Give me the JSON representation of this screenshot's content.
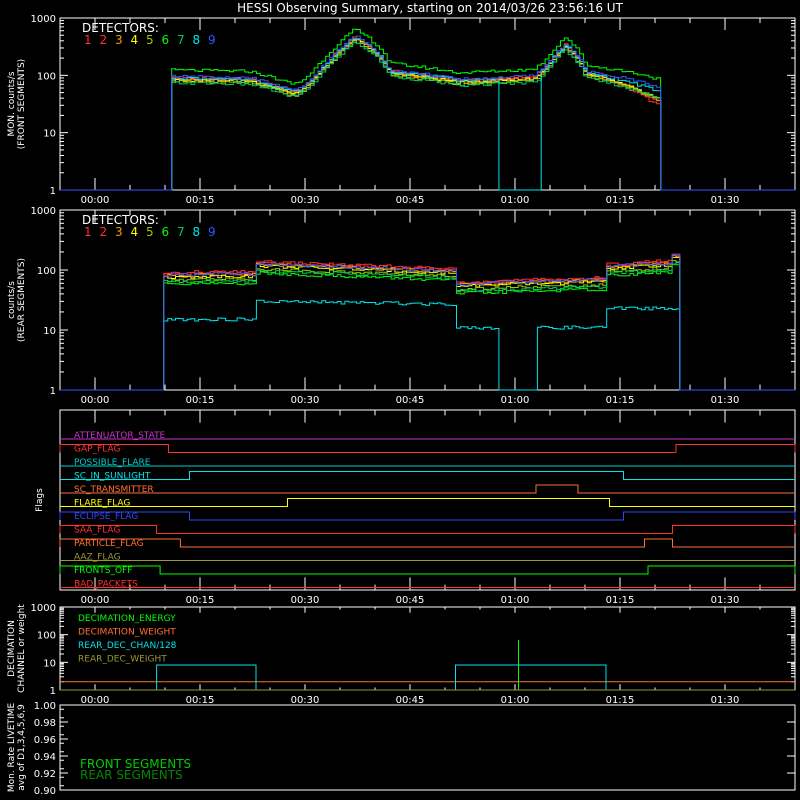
{
  "title": "HESSI Observing Summary, starting on 2014/03/26 23:56:16 UT",
  "chart_data": [
    {
      "type": "line",
      "panel": "front",
      "ylabel": [
        "MON. counts/s",
        "(FRONT SEGMENTS)"
      ],
      "ylog": true,
      "ylim": [
        1,
        1000
      ],
      "yticks": [
        "1",
        "10",
        "100",
        "1000"
      ],
      "xlim_minutes": [
        -5,
        100
      ],
      "xticks": [
        {
          "min": 0,
          "label": "00:00"
        },
        {
          "min": 15,
          "label": "00:15"
        },
        {
          "min": 30,
          "label": "00:30"
        },
        {
          "min": 45,
          "label": "00:45"
        },
        {
          "min": 60,
          "label": "01:00"
        },
        {
          "min": 75,
          "label": "01:15"
        },
        {
          "min": 90,
          "label": "01:30"
        }
      ],
      "legend_title": "DETECTORS:",
      "legend_location": "top-left",
      "series": [
        {
          "name": "1",
          "color": "#ff3030",
          "shape": "front",
          "scale": 0.92,
          "tail": 0.6
        },
        {
          "name": "2",
          "color": "#ff3030",
          "shape": "front",
          "scale": 0.95,
          "tail": 0.7
        },
        {
          "name": "3",
          "color": "#ff9900",
          "shape": "front",
          "scale": 0.9,
          "tail": 0.75
        },
        {
          "name": "4",
          "color": "#ffff00",
          "shape": "front",
          "scale": 0.88,
          "tail": 0.8
        },
        {
          "name": "5",
          "color": "#99cc00",
          "shape": "front",
          "scale": 0.82,
          "tail": 0.85
        },
        {
          "name": "6",
          "color": "#00ff00",
          "shape": "front",
          "scale": 1.3,
          "tail": 1.2
        },
        {
          "name": "7",
          "color": "#00cc66",
          "shape": "front",
          "scale": 0.78,
          "tail": 0.9
        },
        {
          "name": "8",
          "color": "#00e5ee",
          "shape": "front8",
          "scale": 0.95,
          "tail": 1.0
        },
        {
          "name": "9",
          "color": "#3355ff",
          "shape": "front",
          "scale": 1.0,
          "tail": 1.15
        }
      ]
    },
    {
      "type": "line",
      "panel": "rear",
      "ylabel": [
        "counts/s",
        "(REAR SEGMENTS)"
      ],
      "ylog": true,
      "ylim": [
        1,
        1000
      ],
      "yticks": [
        "1",
        "10",
        "100",
        "1000"
      ],
      "xlim_minutes": [
        -5,
        100
      ],
      "xticks": [
        {
          "min": 0,
          "label": "00:00"
        },
        {
          "min": 15,
          "label": "00:15"
        },
        {
          "min": 30,
          "label": "00:30"
        },
        {
          "min": 45,
          "label": "00:45"
        },
        {
          "min": 60,
          "label": "01:00"
        },
        {
          "min": 75,
          "label": "01:15"
        },
        {
          "min": 90,
          "label": "01:30"
        }
      ],
      "legend_title": "DETECTORS:",
      "legend_location": "top-left",
      "series": [
        {
          "name": "1",
          "color": "#ff3030",
          "shape": "rear",
          "scale": 1.05
        },
        {
          "name": "2",
          "color": "#ff3030",
          "shape": "rear",
          "scale": 1.0
        },
        {
          "name": "3",
          "color": "#ff9900",
          "shape": "rear",
          "scale": 0.95
        },
        {
          "name": "4",
          "color": "#ffff00",
          "shape": "rear",
          "scale": 0.9
        },
        {
          "name": "5",
          "color": "#99cc00",
          "shape": "rear",
          "scale": 0.8
        },
        {
          "name": "6",
          "color": "#00ff00",
          "shape": "rear",
          "scale": 0.68
        },
        {
          "name": "7",
          "color": "#00cc66",
          "shape": "rear",
          "scale": 0.75
        },
        {
          "name": "8",
          "color": "#00e5ee",
          "shape": "rear8",
          "scale": 1.0
        },
        {
          "name": "9",
          "color": "#3355ff",
          "shape": "rear",
          "scale": 0.97
        }
      ]
    },
    {
      "type": "line",
      "panel": "flags",
      "ylabel": [
        "Flags"
      ],
      "xlim_minutes": [
        -5,
        100
      ],
      "xticks": [
        {
          "min": 0,
          "label": "00:00"
        },
        {
          "min": 15,
          "label": "00:15"
        },
        {
          "min": 30,
          "label": "00:30"
        },
        {
          "min": 45,
          "label": "00:45"
        },
        {
          "min": 60,
          "label": "01:00"
        },
        {
          "min": 75,
          "label": "01:15"
        },
        {
          "min": 90,
          "label": "01:30"
        }
      ],
      "series": [
        {
          "name": "ATTENUATOR_STATE",
          "color": "#cc33cc",
          "high_intervals": []
        },
        {
          "name": "GAP_FLAG",
          "color": "#ff3030",
          "high_intervals": [
            [
              -5,
              10.5
            ],
            [
              83,
              100
            ]
          ]
        },
        {
          "name": "POSSIBLE_FLARE",
          "color": "#00cccc",
          "high_intervals": []
        },
        {
          "name": "SC_IN_SUNLIGHT",
          "color": "#00e5ee",
          "high_intervals": [
            [
              13.5,
              75.5
            ]
          ]
        },
        {
          "name": "SC_TRANSMITTER",
          "color": "#ff7030",
          "high_intervals": [
            [
              63,
              69
            ]
          ]
        },
        {
          "name": "FLARE_FLAG",
          "color": "#ffff00",
          "high_intervals": [
            [
              27.5,
              73.5
            ]
          ]
        },
        {
          "name": "ECLIPSE_FLAG",
          "color": "#3344ff",
          "high_intervals": [
            [
              -5,
              13.5
            ],
            [
              75.5,
              100
            ]
          ]
        },
        {
          "name": "SAA_FLAG",
          "color": "#ff3030",
          "high_intervals": [
            [
              -5,
              8.8
            ],
            [
              82.5,
              100
            ]
          ]
        },
        {
          "name": "PARTICLE_FLAG",
          "color": "#ff7030",
          "high_intervals": [
            [
              -5,
              12.2
            ],
            [
              78.5,
              82.5
            ]
          ]
        },
        {
          "name": "AAZ_FLAG",
          "color": "#999933",
          "high_intervals": []
        },
        {
          "name": "FRONTS_OFF",
          "color": "#00ff00",
          "high_intervals": [
            [
              -5,
              9.3
            ],
            [
              79,
              100
            ]
          ]
        },
        {
          "name": "BAD_PACKETS",
          "color": "#ff3030",
          "high_intervals": []
        }
      ]
    },
    {
      "type": "line",
      "panel": "decimation",
      "ylabel": [
        "DECIMATION",
        "CHANNEL or weight"
      ],
      "ylog": true,
      "ylim": [
        1,
        1000
      ],
      "yticks": [
        "1",
        "10",
        "100",
        "1000"
      ],
      "xlim_minutes": [
        -5,
        100
      ],
      "xticks": [
        {
          "min": 0,
          "label": "00:00"
        },
        {
          "min": 15,
          "label": "00:15"
        },
        {
          "min": 30,
          "label": "00:30"
        },
        {
          "min": 45,
          "label": "00:45"
        },
        {
          "min": 60,
          "label": "01:00"
        },
        {
          "min": 75,
          "label": "01:15"
        },
        {
          "min": 90,
          "label": "01:30"
        }
      ],
      "series": [
        {
          "name": "DECIMATION_ENERGY",
          "color": "#00ff00",
          "steps": [
            [
              -5,
              1
            ],
            [
              60.5,
              64
            ],
            [
              60.5,
              1
            ],
            [
              100,
              1
            ]
          ]
        },
        {
          "name": "DECIMATION_WEIGHT",
          "color": "#ff7030",
          "steps": [
            [
              -5,
              2
            ],
            [
              100,
              2
            ]
          ]
        },
        {
          "name": "REAR_DEC_CHAN/128",
          "color": "#00e5ee",
          "steps": [
            [
              -5,
              1
            ],
            [
              8.8,
              8
            ],
            [
              23,
              1
            ],
            [
              51.5,
              8
            ],
            [
              73,
              1
            ],
            [
              100,
              1
            ]
          ]
        },
        {
          "name": "REAR_DEC_WEIGHT",
          "color": "#999933",
          "steps": [
            [
              -5,
              1
            ],
            [
              100,
              1
            ]
          ]
        }
      ]
    },
    {
      "type": "line",
      "panel": "livetime",
      "ylabel": [
        "Mon. Rate LIVETIME",
        "avg of D1,3,4,5,6,9"
      ],
      "ylim": [
        0.9,
        1.0
      ],
      "yticks": [
        "0.90",
        "0.92",
        "0.94",
        "0.96",
        "0.98",
        "1.00"
      ],
      "series": [
        {
          "name": "FRONT SEGMENTS",
          "color": "#00cc00"
        },
        {
          "name": "REAR SEGMENTS",
          "color": "#008800"
        }
      ]
    }
  ]
}
